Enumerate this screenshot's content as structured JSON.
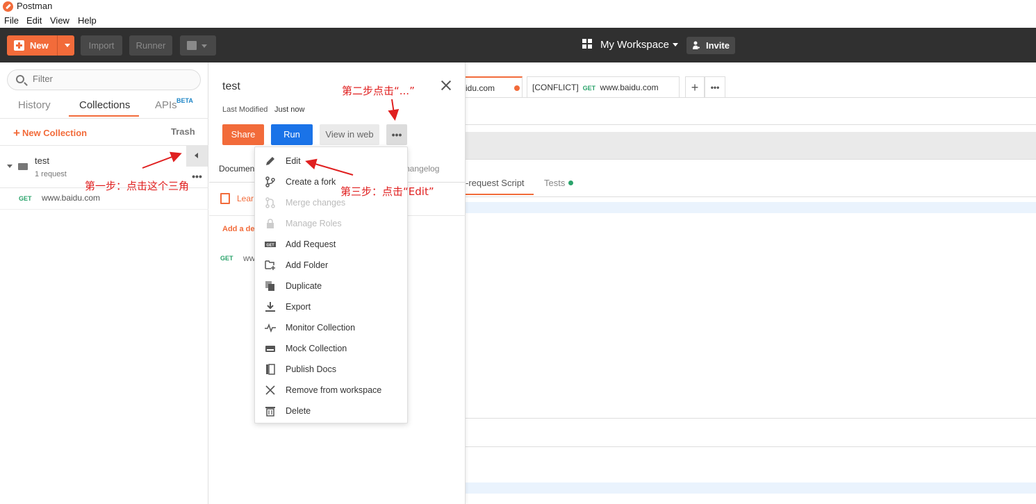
{
  "window": {
    "title": "Postman"
  },
  "menubar": [
    "File",
    "Edit",
    "View",
    "Help"
  ],
  "header": {
    "new_label": "New",
    "import_label": "Import",
    "runner_label": "Runner",
    "workspace_label": "My Workspace",
    "invite_label": "Invite"
  },
  "sidebar": {
    "filter_placeholder": "Filter",
    "tabs": [
      "History",
      "Collections",
      "APIs"
    ],
    "beta_badge": "BETA",
    "new_collection": "New Collection",
    "trash": "Trash",
    "collection": {
      "name": "test",
      "count": "1 request"
    },
    "request": {
      "method": "GET",
      "url": "www.baidu.com"
    }
  },
  "main": {
    "tab1_label": "idu.com",
    "tab2_prefix": "[CONFLICT]",
    "tab2_method": "GET",
    "tab2_url": "www.baidu.com",
    "prerequest_label": "-request Script",
    "tests_label": "Tests"
  },
  "panel": {
    "title": "test",
    "last_modified_label": "Last Modified",
    "last_modified_value": "Just now",
    "share": "Share",
    "run": "Run",
    "view_web": "View in web",
    "more": "•••",
    "doc_tab": "Documen",
    "changelog": "hangelog",
    "learn": "Lear",
    "add_desc": "Add a des",
    "req_method": "GET",
    "req_url": "ww"
  },
  "menu": [
    {
      "label": "Edit",
      "icon": "pencil-icon",
      "enabled": true
    },
    {
      "label": "Create a fork",
      "icon": "fork-icon",
      "enabled": true
    },
    {
      "label": "Merge changes",
      "icon": "merge-icon",
      "enabled": false
    },
    {
      "label": "Manage Roles",
      "icon": "lock-icon",
      "enabled": false
    },
    {
      "label": "Add Request",
      "icon": "get-badge-icon",
      "enabled": true
    },
    {
      "label": "Add Folder",
      "icon": "add-folder-icon",
      "enabled": true
    },
    {
      "label": "Duplicate",
      "icon": "duplicate-icon",
      "enabled": true
    },
    {
      "label": "Export",
      "icon": "download-icon",
      "enabled": true
    },
    {
      "label": "Monitor Collection",
      "icon": "pulse-icon",
      "enabled": true
    },
    {
      "label": "Mock Collection",
      "icon": "server-icon",
      "enabled": true
    },
    {
      "label": "Publish Docs",
      "icon": "book-icon",
      "enabled": true
    },
    {
      "label": "Remove from workspace",
      "icon": "x-icon",
      "enabled": true
    },
    {
      "label": "Delete",
      "icon": "trash-icon",
      "enabled": true
    }
  ],
  "annotations": {
    "step1": "第一步：点击这个三角",
    "step2": "第二步点击“...”",
    "step3": "第三步：点击“Edit”"
  },
  "colors": {
    "brand": "#f26b3a",
    "run": "#1a73e8",
    "get": "#2aa36b",
    "annotation": "#e02020"
  }
}
